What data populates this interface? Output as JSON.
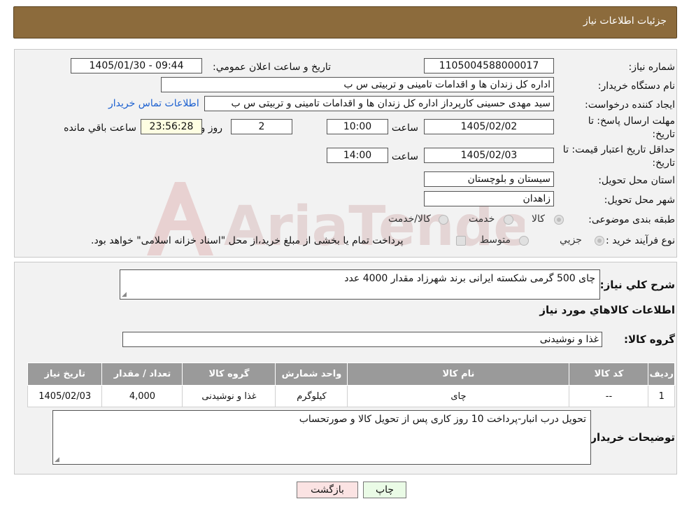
{
  "header": {
    "title": "جزئيات اطلاعات نياز"
  },
  "form": {
    "need_number_label": "شماره نياز:",
    "need_number": "1105004588000017",
    "announce_label": "تاريخ و ساعت اعلان عمومي:",
    "announce_value": "1405/01/30 - 09:44",
    "buyer_org_label": "نام دستگاه خريدار:",
    "buyer_org": "اداره کل زندان ها و اقدامات تامینی و تربیتی س ب",
    "creator_label": "ايجاد کننده درخواست:",
    "creator": "سید مهدی حسینی کارپرداز اداره کل زندان ها و اقدامات تامینی و تربیتی س ب",
    "contact_link": "اطلاعات تماس خريدار",
    "reply_deadline_label": "مهلت ارسال پاسخ: تا تاريخ:",
    "reply_date": "1405/02/02",
    "time_label": "ساعت",
    "reply_time": "10:00",
    "days": "2",
    "days_label": "روز و",
    "remaining": "23:56:28",
    "remaining_label": "ساعت باقي مانده",
    "price_validity_label": "حداقل تاريخ اعتبار قيمت: تا تاريخ:",
    "price_date": "1405/02/03",
    "price_time": "14:00",
    "province_label": "استان محل تحويل:",
    "province": "سیستان و بلوچستان",
    "city_label": "شهر محل تحويل:",
    "city": "زاهدان",
    "category_label": "طبقه بندی موضوعی:",
    "category_options": [
      "کالا",
      "خدمت",
      "کالا/خدمت"
    ],
    "process_label": "نوع فرآيند خريد :",
    "process_options": [
      "جزیي",
      "متوسط"
    ],
    "process_note": "پرداخت تمام یا بخشی از مبلغ خرید،از محل \"اسناد خزانه اسلامی\" خواهد بود."
  },
  "details": {
    "summary_label": "شرح کلي نياز:",
    "summary": "چای 500 گرمی شکسته ایرانی برند شهرزاد مقدار 4000 عدد",
    "items_title": "اطلاعات کالاهاي مورد نياز",
    "group_label": "گروه کالا:",
    "group": "غذا و نوشیدنی",
    "table": {
      "headers": [
        "رديف",
        "کد کالا",
        "نام کالا",
        "واحد شمارش",
        "گروه کالا",
        "تعداد / مقدار",
        "تاريخ نياز"
      ],
      "rows": [
        [
          "1",
          "--",
          "چای",
          "کیلوگرم",
          "غذا و نوشیدنی",
          "4,000",
          "1405/02/03"
        ]
      ]
    },
    "buyer_notes_label": "توضيحات خريدار:",
    "buyer_notes": "تحویل درب انبار-پرداخت 10 روز کاری پس از تحویل کالا و صورتحساب"
  },
  "buttons": {
    "print": "چاپ",
    "back": "بازگشت"
  },
  "watermark": {
    "text": "AriaTender.neT"
  },
  "colors": {
    "header_bg": "#8c6b3c",
    "table_header_bg": "#9a9a9a",
    "link": "#1a5fd0",
    "back_btn_bg": "#fbe3e3",
    "print_btn_bg": "#eafbe6"
  }
}
